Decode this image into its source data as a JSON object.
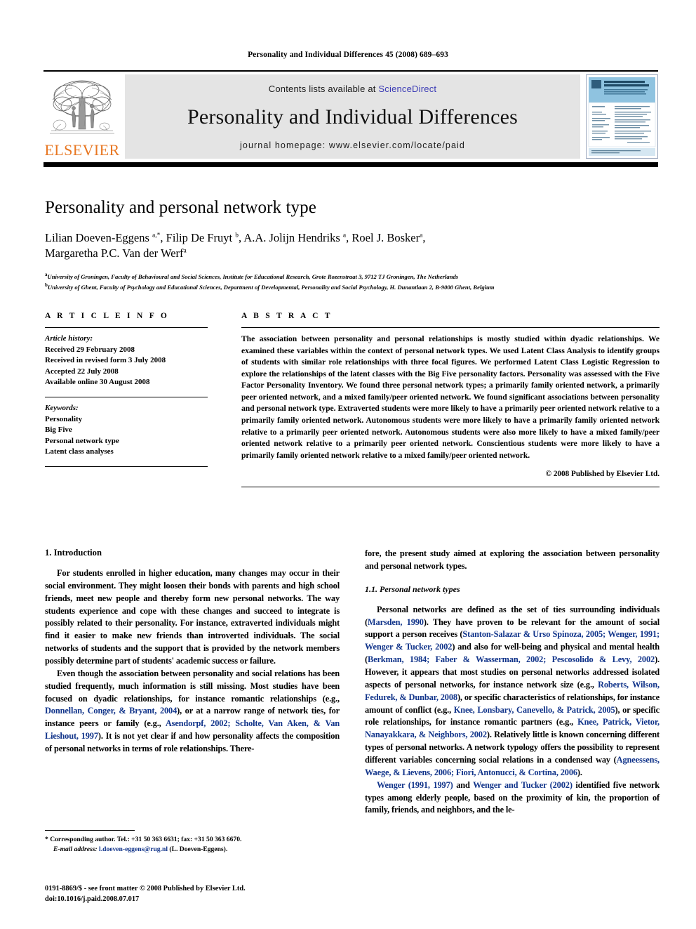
{
  "running_head": "Personality and Individual Differences 45 (2008) 689–693",
  "masthead": {
    "contents_prefix": "Contents lists available at ",
    "sciencedirect": "ScienceDirect",
    "journal_name": "Personality and Individual Differences",
    "homepage": "journal homepage: www.elsevier.com/locate/paid",
    "publisher_wordmark": "ELSEVIER",
    "publisher_accent_color": "#E87722",
    "link_color": "#3b3bb5",
    "banner_bg": "#e4e4e4",
    "cover": {
      "title_line1": "PERSONALITY AND",
      "title_line2": "INDIVIDUAL DIFFERENCES",
      "accent_color": "#8fc3e0"
    }
  },
  "article": {
    "title": "Personality and personal network type",
    "authors_line1": "Lilian Doeven-Eggens ",
    "authors_line1_sup1": "a,*",
    "authors_line1_b": ", Filip De Fruyt ",
    "authors_line1_sup2": "b",
    "authors_line1_c": ", A.A. Jolijn Hendriks ",
    "authors_line1_sup3": "a",
    "authors_line1_d": ", Roel J. Bosker",
    "authors_line1_sup4": "a",
    "authors_line1_e": ",",
    "authors_line2": "Margaretha P.C. Van der Werf",
    "authors_line2_sup": "a",
    "affiliation_a_marker": "a",
    "affiliation_a": "University of Groningen, Faculty of Behavioural and Social Sciences, Institute for Educational Research, Grote Rozenstraat 3, 9712 TJ Groningen, The Netherlands",
    "affiliation_b_marker": "b",
    "affiliation_b": "University of Ghent, Faculty of Psychology and Educational Sciences, Department of Developmental, Personality and Social Psychology, H. Dunantlaan 2, B-9000 Ghent, Belgium"
  },
  "article_info": {
    "section_label": "A R T I C L E   I N F O",
    "history_title": "Article history:",
    "history": [
      "Received 29 February 2008",
      "Received in revised form 3 July 2008",
      "Accepted 22 July 2008",
      "Available online 30 August 2008"
    ],
    "keywords_title": "Keywords:",
    "keywords": [
      "Personality",
      "Big Five",
      "Personal network type",
      "Latent class analyses"
    ]
  },
  "abstract": {
    "section_label": "A B S T R A C T",
    "text": "The association between personality and personal relationships is mostly studied within dyadic relationships. We examined these variables within the context of personal network types. We used Latent Class Analysis to identify groups of students with similar role relationships with three focal figures. We performed Latent Class Logistic Regression to explore the relationships of the latent classes with the Big Five personality factors. Personality was assessed with the Five Factor Personality Inventory. We found three personal network types; a primarily family oriented network, a primarily peer oriented network, and a mixed family/peer oriented network. We found significant associations between personality and personal network type. Extraverted students were more likely to have a primarily peer oriented network relative to a primarily family oriented network. Autonomous students were more likely to have a primarily family oriented network relative to a primarily peer oriented network. Autonomous students were also more likely to have a mixed family/peer oriented network relative to a primarily peer oriented network. Conscientious students were more likely to have a primarily family oriented network relative to a mixed family/peer oriented network.",
    "copyright": "© 2008 Published by Elsevier Ltd."
  },
  "body": {
    "left": {
      "heading": "1. Introduction",
      "para1": "For students enrolled in higher education, many changes may occur in their social environment. They might loosen their bonds with parents and high school friends, meet new people and thereby form new personal networks. The way students experience and cope with these changes and succeed to integrate is possibly related to their personality. For instance, extraverted individuals might find it easier to make new friends than introverted individuals. The social networks of students and the support that is provided by the network members possibly determine part of students' academic success or failure.",
      "para2_a": "Even though the association between personality and social relations has been studied frequently, much information is still missing. Most studies have been focused on dyadic relationships, for instance romantic relationships (e.g., ",
      "para2_ref1": "Donnellan, Conger, & Bryant, 2004",
      "para2_b": "), or at a narrow range of network ties, for instance peers or family (e.g., ",
      "para2_ref2": "Asendorpf, 2002; Scholte, Van Aken, & Van Lieshout, 1997",
      "para2_c": "). It is not yet clear if and how personality affects the composition of personal networks in terms of role relationships. There-"
    },
    "right": {
      "para1": "fore, the present study aimed at exploring the association between personality and personal network types.",
      "heading": "1.1. Personal network types",
      "para2_a": "Personal networks are defined as the set of ties surrounding individuals (",
      "para2_ref1": "Marsden, 1990",
      "para2_b": "). They have proven to be relevant for the amount of social support a person receives (",
      "para2_ref2": "Stanton-Salazar & Urso Spinoza, 2005; Wenger, 1991; Wenger & Tucker, 2002",
      "para2_c": ") and also for well-being and physical and mental health (",
      "para2_ref3": "Berkman, 1984; Faber & Wasserman, 2002; Pescosolido & Levy, 2002",
      "para2_d": "). However, it appears that most studies on personal networks addressed isolated aspects of personal networks, for instance network size (e.g., ",
      "para2_ref4": "Roberts, Wilson, Fedurek, & Dunbar, 2008",
      "para2_e": "), or specific characteristics of relationships, for instance amount of conflict (e.g., ",
      "para2_ref5": "Knee, Lonsbary, Canevello, & Patrick, 2005",
      "para2_f": "), or specific role relationships, for instance romantic partners (e.g., ",
      "para2_ref6": "Knee, Patrick, Vietor, Nanayakkara, & Neighbors, 2002",
      "para2_g": "). Relatively little is known concerning different types of personal networks. A network typology offers the possibility to represent different variables concerning social relations in a condensed way (",
      "para2_ref7": "Agneessens, Waege, & Lievens, 2006; Fiori, Antonucci, & Cortina, 2006",
      "para2_h": ").",
      "para3_ref1": "Wenger (1991, 1997)",
      "para3_a": " and ",
      "para3_ref2": "Wenger and Tucker (2002)",
      "para3_b": " identified five network types among elderly people, based on the proximity of kin, the proportion of family, friends, and neighbors, and the le-"
    }
  },
  "footnote": {
    "marker": "*",
    "line1": "Corresponding author. Tel.: +31 50 363 6631; fax: +31 50 363 6670.",
    "email_label": "E-mail address:",
    "email": "l.doeven-eggens@rug.nl",
    "email_suffix": "(L. Doeven-Eggens)."
  },
  "footer": {
    "line1": "0191-8869/$ - see front matter © 2008 Published by Elsevier Ltd.",
    "line2": "doi:10.1016/j.paid.2008.07.017"
  }
}
